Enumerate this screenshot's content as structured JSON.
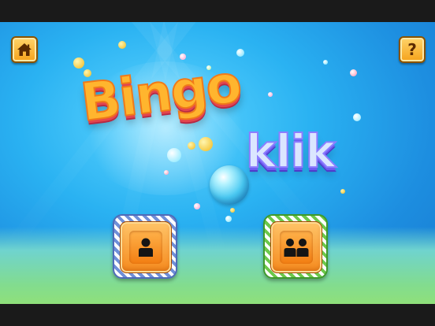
{
  "title": {
    "word1": "Bingo",
    "word2": "klik"
  },
  "controls": {
    "home_icon": "home-icon",
    "help_label": "?"
  },
  "modes": [
    {
      "icon": "single-player-icon"
    },
    {
      "icon": "multiplayer-icon"
    }
  ],
  "colors": {
    "sky": "#2ab2f2",
    "grass": "#8fe07a",
    "button_orange": "#f5a21a",
    "bingo_orange": "#ffb52e",
    "klik_purple": "#8d7dff"
  }
}
